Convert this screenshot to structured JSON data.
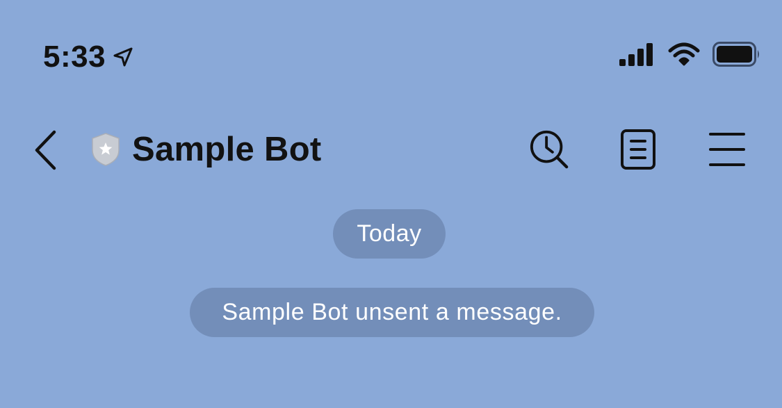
{
  "status_bar": {
    "time": "5:33",
    "icons": [
      "location-arrow-icon",
      "cellular-signal-icon",
      "wifi-icon",
      "battery-icon"
    ]
  },
  "nav_bar": {
    "back_icon": "chevron-left-icon",
    "title_badge_icon": "shield-star-icon",
    "title": "Sample Bot",
    "actions": [
      {
        "icon": "search-history-icon"
      },
      {
        "icon": "notes-icon"
      },
      {
        "icon": "menu-icon"
      }
    ]
  },
  "chat": {
    "date_separator": "Today",
    "system_message": "Sample Bot unsent a message."
  },
  "colors": {
    "background": "#8aa9d8",
    "pill_background": "#6f8cba",
    "pill_text": "#ffffff",
    "icon": "#111111"
  }
}
